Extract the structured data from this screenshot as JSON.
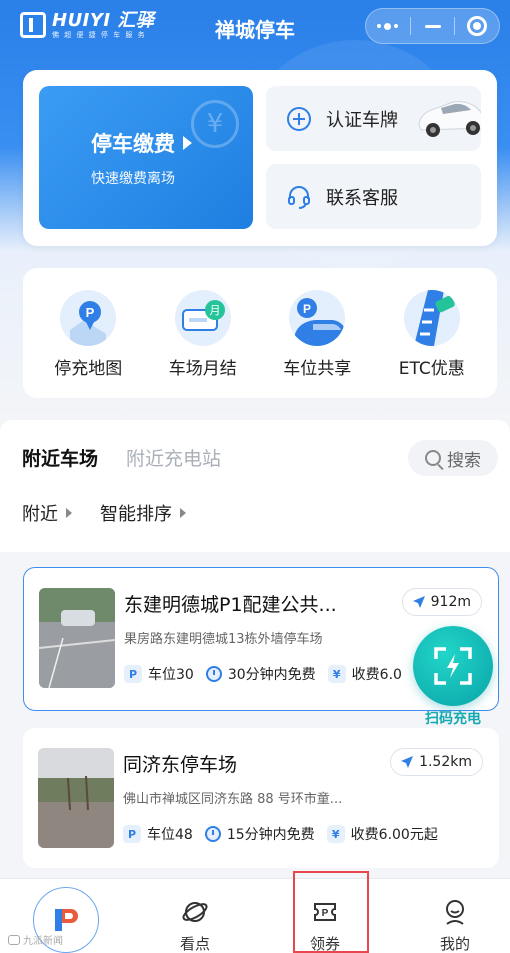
{
  "header": {
    "logo_main": "HUIYI 汇驿",
    "logo_sub": "佛 超 便 捷 停 车 服 务",
    "title": "禅城停车"
  },
  "main_card": {
    "pay_title": "停车缴费",
    "pay_subtitle": "快速缴费离场",
    "plate_auth": "认证车牌",
    "customer_service": "联系客服"
  },
  "quick_entries": [
    {
      "label": "停充地图",
      "icon": "parking-map-icon"
    },
    {
      "label": "车场月结",
      "icon": "monthly-pass-icon"
    },
    {
      "label": "车位共享",
      "icon": "space-share-icon"
    },
    {
      "label": "ETC优惠",
      "icon": "etc-discount-icon"
    }
  ],
  "nearby": {
    "tabs": [
      "附近车场",
      "附近充电站"
    ],
    "active_tab": 0,
    "search_label": "搜索",
    "filters": [
      "附近",
      "智能排序"
    ]
  },
  "lots": [
    {
      "name": "东建明德城P1配建公共...",
      "address": "果房路东建明德城13栋外墙停车场",
      "distance": "912m",
      "spaces": "车位30",
      "free_time": "30分钟内免费",
      "fee": "收费6.0"
    },
    {
      "name": "同济东停车场",
      "address": "佛山市禅城区同济东路 88 号环市童...",
      "distance": "1.52km",
      "spaces": "车位48",
      "free_time": "15分钟内免费",
      "fee": "收费6.00元起"
    }
  ],
  "scan_charge": {
    "label": "扫码充电"
  },
  "bottom_nav": [
    {
      "label": "",
      "icon": "home-logo-icon"
    },
    {
      "label": "看点",
      "icon": "planet-icon"
    },
    {
      "label": "领券",
      "icon": "coupon-icon"
    },
    {
      "label": "我的",
      "icon": "profile-icon"
    }
  ],
  "watermark": "九派新闻",
  "colors": {
    "primary": "#2f7fe6",
    "teal": "#14a9b1",
    "highlight": "#e8474e"
  }
}
